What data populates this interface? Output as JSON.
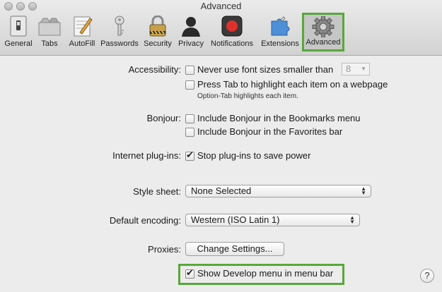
{
  "window": {
    "title": "Advanced"
  },
  "toolbar": {
    "items": [
      {
        "label": "General",
        "icon": "switch-icon"
      },
      {
        "label": "Tabs",
        "icon": "tabs-icon"
      },
      {
        "label": "AutoFill",
        "icon": "pencil-form-icon"
      },
      {
        "label": "Passwords",
        "icon": "key-icon"
      },
      {
        "label": "Security",
        "icon": "padlock-icon"
      },
      {
        "label": "Privacy",
        "icon": "person-silhouette-icon"
      },
      {
        "label": "Notifications",
        "icon": "record-button-icon"
      },
      {
        "label": "Extensions",
        "icon": "puzzle-icon"
      },
      {
        "label": "Advanced",
        "icon": "gear-icon",
        "selected": true
      }
    ]
  },
  "accessibility": {
    "label": "Accessibility:",
    "font_size_option": "Never use font sizes smaller than",
    "font_size_value": "8",
    "tab_option": "Press Tab to highlight each item on a webpage",
    "tab_hint": "Option-Tab highlights each item."
  },
  "bonjour": {
    "label": "Bonjour:",
    "bookmarks_option": "Include Bonjour in the Bookmarks menu",
    "favorites_option": "Include Bonjour in the Favorites bar"
  },
  "plugins": {
    "label": "Internet plug-ins:",
    "stop_option": "Stop plug-ins to save power"
  },
  "style_sheet": {
    "label": "Style sheet:",
    "value": "None Selected"
  },
  "encoding": {
    "label": "Default encoding:",
    "value": "Western (ISO Latin 1)"
  },
  "proxies": {
    "label": "Proxies:",
    "button": "Change Settings..."
  },
  "develop": {
    "option": "Show Develop menu in menu bar"
  },
  "help": {
    "glyph": "?"
  },
  "colors": {
    "highlight": "#58a83a"
  }
}
